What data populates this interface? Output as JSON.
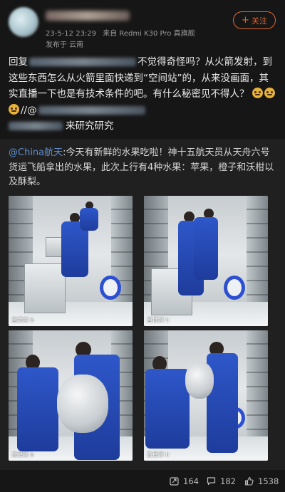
{
  "header": {
    "date": "23-5-12 23:29",
    "source": "来自 Redmi K30 Pro 真旗舰",
    "location": "发布于 云南",
    "follow_label": "关注"
  },
  "post": {
    "line1_prefix": "回复",
    "line1_suffix": "不觉得奇怪吗？从火箭发射，到这些东西怎么从火箭里面快递到“空间站”的，从来没画面，其实直播一下也是有技术条件的吧。有什么秘密见不得人？",
    "line_end_prefix": "//@",
    "line_end_suffix": "来研究研究"
  },
  "repost": {
    "mention": "@China航天",
    "text": ":今天有新鲜的水果吃啦！神十五航天员从天舟六号货运飞船拿出的水果，此次上行有4种水果：苹果，橙子和沃柑以及酥梨。",
    "watermark": "直播帧 b"
  },
  "footer": {
    "reposts": "164",
    "comments": "182",
    "likes": "1538"
  },
  "colors": {
    "accent": "#e06a36",
    "mention": "#5f8ccc",
    "background": "#161616"
  },
  "icons": [
    "plus-icon",
    "repost-icon",
    "comment-icon",
    "like-icon"
  ]
}
